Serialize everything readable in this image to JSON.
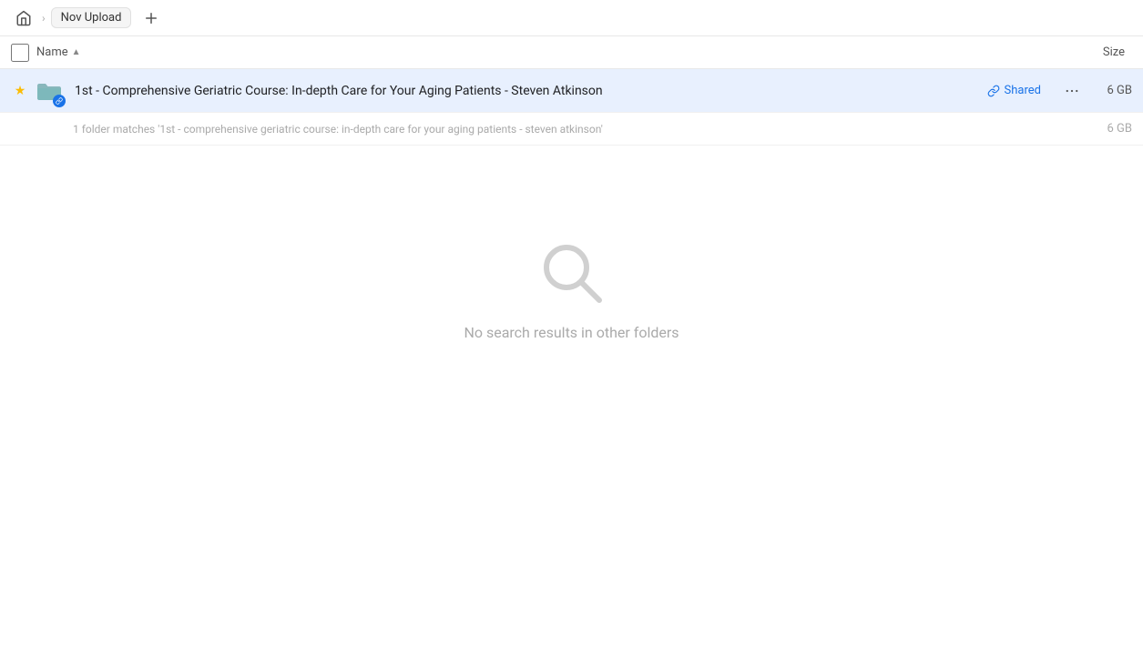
{
  "breadcrumb": {
    "home_label": "Home",
    "current_folder": "Nov Upload",
    "add_tab_label": "+"
  },
  "columns": {
    "name_label": "Name",
    "size_label": "Size"
  },
  "file_row": {
    "name": "1st - Comprehensive Geriatric Course: In-depth Care for Your Aging Patients - Steven Atkinson",
    "shared_label": "Shared",
    "size": "6 GB",
    "star": "★"
  },
  "match_info": {
    "text": "1 folder matches '1st - comprehensive geriatric course: in-depth care for your aging patients - steven atkinson'",
    "size": "6 GB"
  },
  "empty_state": {
    "text": "No search results in other folders"
  },
  "icons": {
    "home": "🏠",
    "chevron_right": "›",
    "sort_asc": "▲",
    "more": "•••",
    "link": "🔗"
  }
}
